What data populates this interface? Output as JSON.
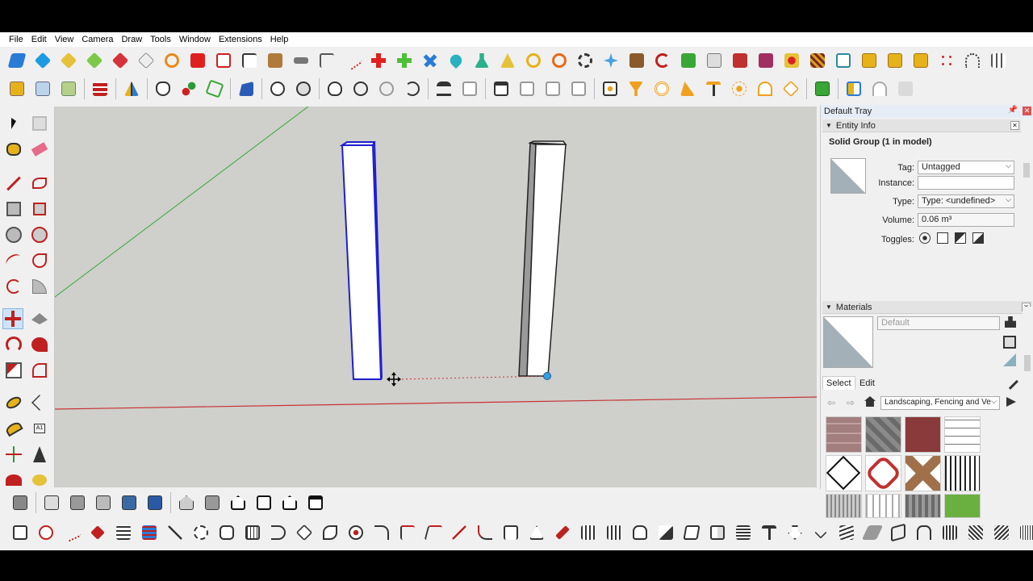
{
  "menu": [
    "File",
    "Edit",
    "View",
    "Camera",
    "Draw",
    "Tools",
    "Window",
    "Extensions",
    "Help"
  ],
  "tray": {
    "title": "Default Tray",
    "entity_info": {
      "header": "Entity Info",
      "selection": "Solid Group (1 in model)",
      "tag_label": "Tag:",
      "tag_value": "Untagged",
      "instance_label": "Instance:",
      "instance_value": "",
      "type_label": "Type:",
      "type_value": "Type: <undefined>",
      "volume_label": "Volume:",
      "volume_value": "0.06 m³",
      "toggles_label": "Toggles:"
    },
    "materials": {
      "header": "Materials",
      "current": "Default",
      "tab_select": "Select",
      "tab_edit": "Edit",
      "collection": "Landscaping, Fencing and Ve"
    }
  },
  "colors": {
    "viewport_bg": "#cfcfcc",
    "green_axis": "#3aa635",
    "red_axis": "#c83232",
    "selection_blue": "#1f1fd0"
  }
}
